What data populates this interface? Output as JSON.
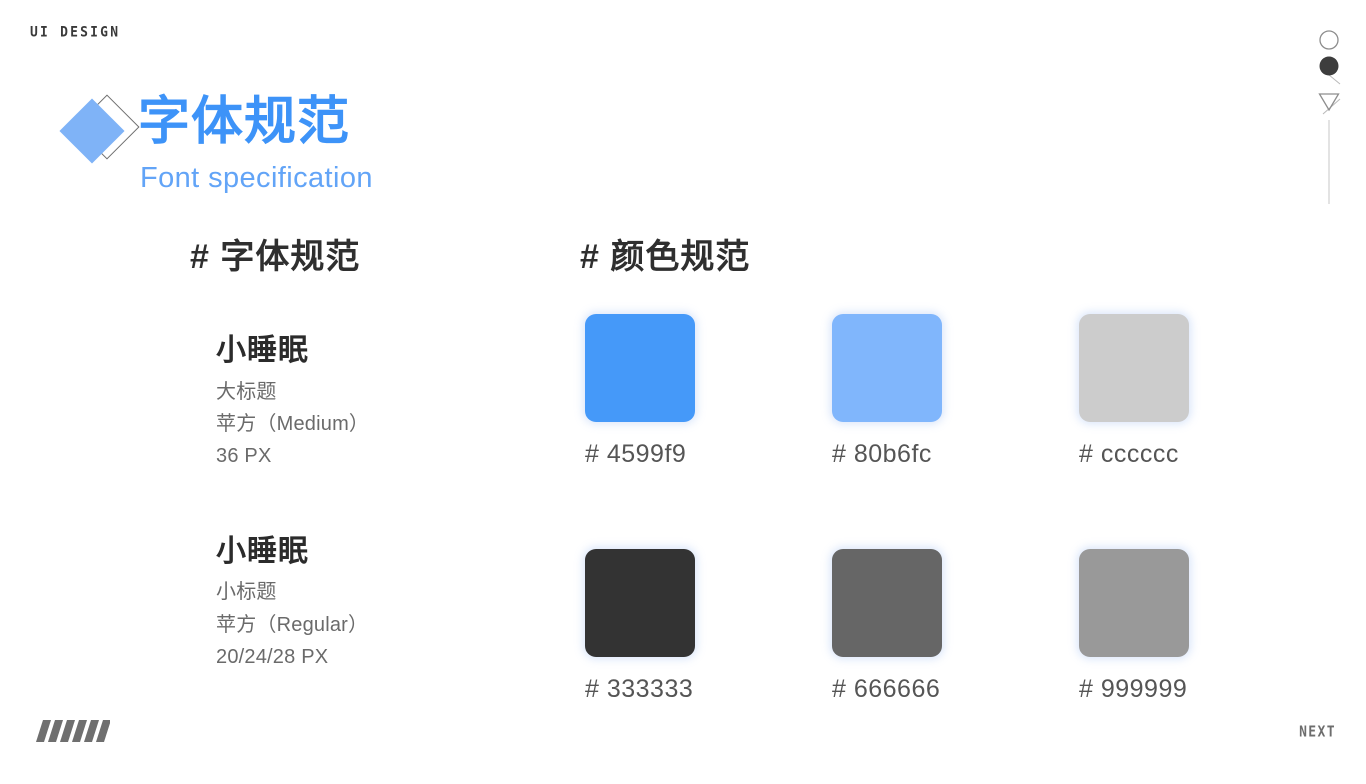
{
  "brand": {
    "label": "UI DESIGN"
  },
  "title": {
    "cn": "字体规范",
    "en": "Font specification",
    "accent_color": "#4599f9",
    "accent_light_color": "#80b6fc"
  },
  "sections": {
    "font_heading": "# 字体规范",
    "color_heading": "# 颜色规范"
  },
  "font_specs": [
    {
      "sample": "小睡眠",
      "usage": "大标题",
      "family": "苹方（Medium）",
      "size": "36 PX"
    },
    {
      "sample": "小睡眠",
      "usage": "小标题",
      "family": "苹方（Regular）",
      "size": "20/24/28 PX"
    }
  ],
  "color_rows": [
    [
      {
        "hex": "#4599f9",
        "label": "# 4599f9"
      },
      {
        "hex": "#80b6fc",
        "label": "# 80b6fc"
      },
      {
        "hex": "#cccccc",
        "label": "# cccccc"
      }
    ],
    [
      {
        "hex": "#333333",
        "label": "# 333333"
      },
      {
        "hex": "#666666",
        "label": "# 666666"
      },
      {
        "hex": "#999999",
        "label": "# 999999"
      }
    ]
  ],
  "footer": {
    "next_label": "NEXT"
  }
}
